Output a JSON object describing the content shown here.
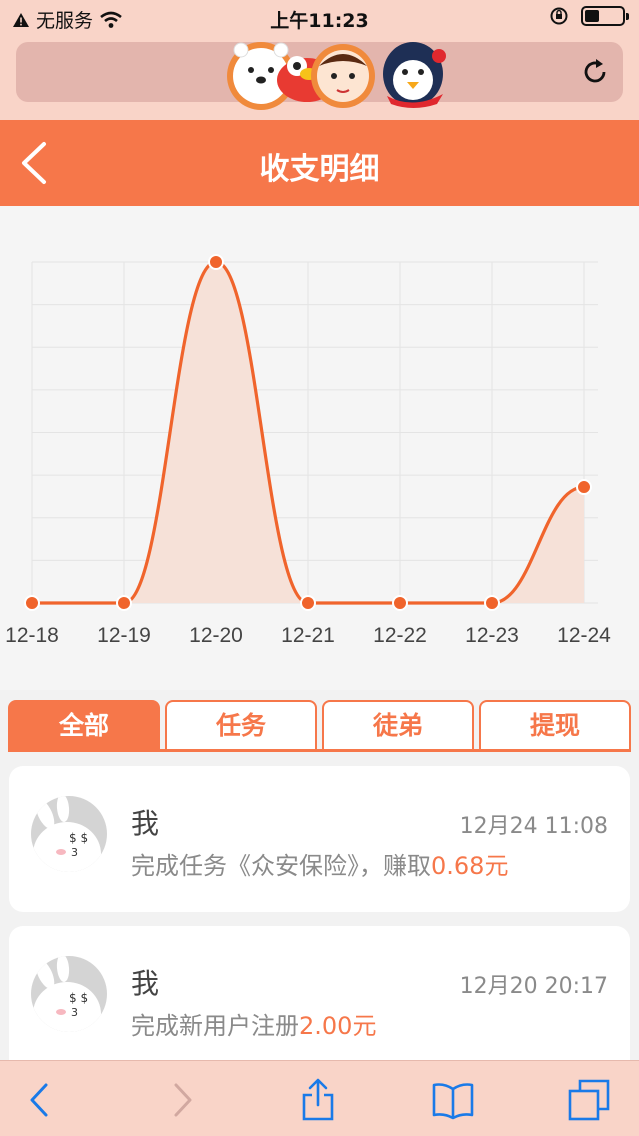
{
  "status_bar": {
    "carrier": "无服务",
    "time": "上午11:23"
  },
  "header": {
    "title": "收支明细"
  },
  "chart_data": {
    "type": "area",
    "categories": [
      "12-18",
      "12-19",
      "12-20",
      "12-21",
      "12-22",
      "12-23",
      "12-24"
    ],
    "values": [
      0,
      0,
      2.0,
      0,
      0,
      0,
      0.68
    ],
    "ylim": [
      0,
      2.0
    ],
    "grid": true,
    "line_color": "#f0642c",
    "fill_color": "#f6e1d8"
  },
  "tabs": [
    {
      "label": "全部",
      "active": true
    },
    {
      "label": "任务",
      "active": false
    },
    {
      "label": "徒弟",
      "active": false
    },
    {
      "label": "提现",
      "active": false
    }
  ],
  "records": [
    {
      "name": "我",
      "time": "12月24 11:08",
      "desc": "完成任务《众安保险》，赚取",
      "amount": "0.68元"
    },
    {
      "name": "我",
      "time": "12月20 20:17",
      "desc": "完成新用户注册",
      "amount": "2.00元"
    }
  ],
  "colors": {
    "accent": "#f6774a",
    "bar_bg": "#f9d4c8",
    "ios_blue": "#1a7ae8"
  }
}
